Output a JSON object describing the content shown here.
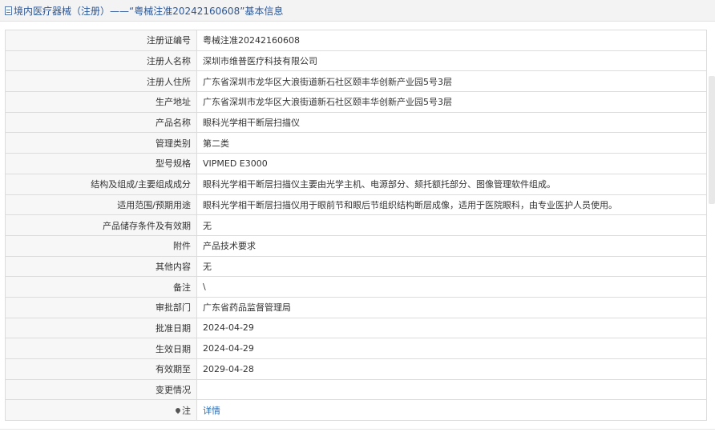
{
  "header": {
    "title": "境内医疗器械（注册）——“粤械注准20242160608”基本信息"
  },
  "rows": [
    {
      "label": "注册证编号",
      "value": "粤械注准20242160608"
    },
    {
      "label": "注册人名称",
      "value": "深圳市维普医疗科技有限公司"
    },
    {
      "label": "注册人住所",
      "value": "广东省深圳市龙华区大浪街道新石社区颐丰华创新产业园5号3层"
    },
    {
      "label": "生产地址",
      "value": "广东省深圳市龙华区大浪街道新石社区颐丰华创新产业园5号3层"
    },
    {
      "label": "产品名称",
      "value": "眼科光学相干断层扫描仪"
    },
    {
      "label": "管理类别",
      "value": "第二类"
    },
    {
      "label": "型号规格",
      "value": "VIPMED E3000"
    },
    {
      "label": "结构及组成/主要组成成分",
      "value": "眼科光学相干断层扫描仪主要由光学主机、电源部分、颏托额托部分、图像管理软件组成。"
    },
    {
      "label": "适用范围/预期用途",
      "value": "眼科光学相干断层扫描仪用于眼前节和眼后节组织结构断层成像，适用于医院眼科，由专业医护人员使用。"
    },
    {
      "label": "产品储存条件及有效期",
      "value": "无"
    },
    {
      "label": "附件",
      "value": "产品技术要求"
    },
    {
      "label": "其他内容",
      "value": "无"
    },
    {
      "label": "备注",
      "value": "\\"
    },
    {
      "label": "审批部门",
      "value": "广东省药品监督管理局"
    },
    {
      "label": "批准日期",
      "value": "2024-04-29"
    },
    {
      "label": "生效日期",
      "value": "2024-04-29"
    },
    {
      "label": "有效期至",
      "value": "2029-04-28"
    },
    {
      "label": "变更情况",
      "value": ""
    }
  ],
  "note": {
    "label": "注",
    "link": "详情"
  }
}
